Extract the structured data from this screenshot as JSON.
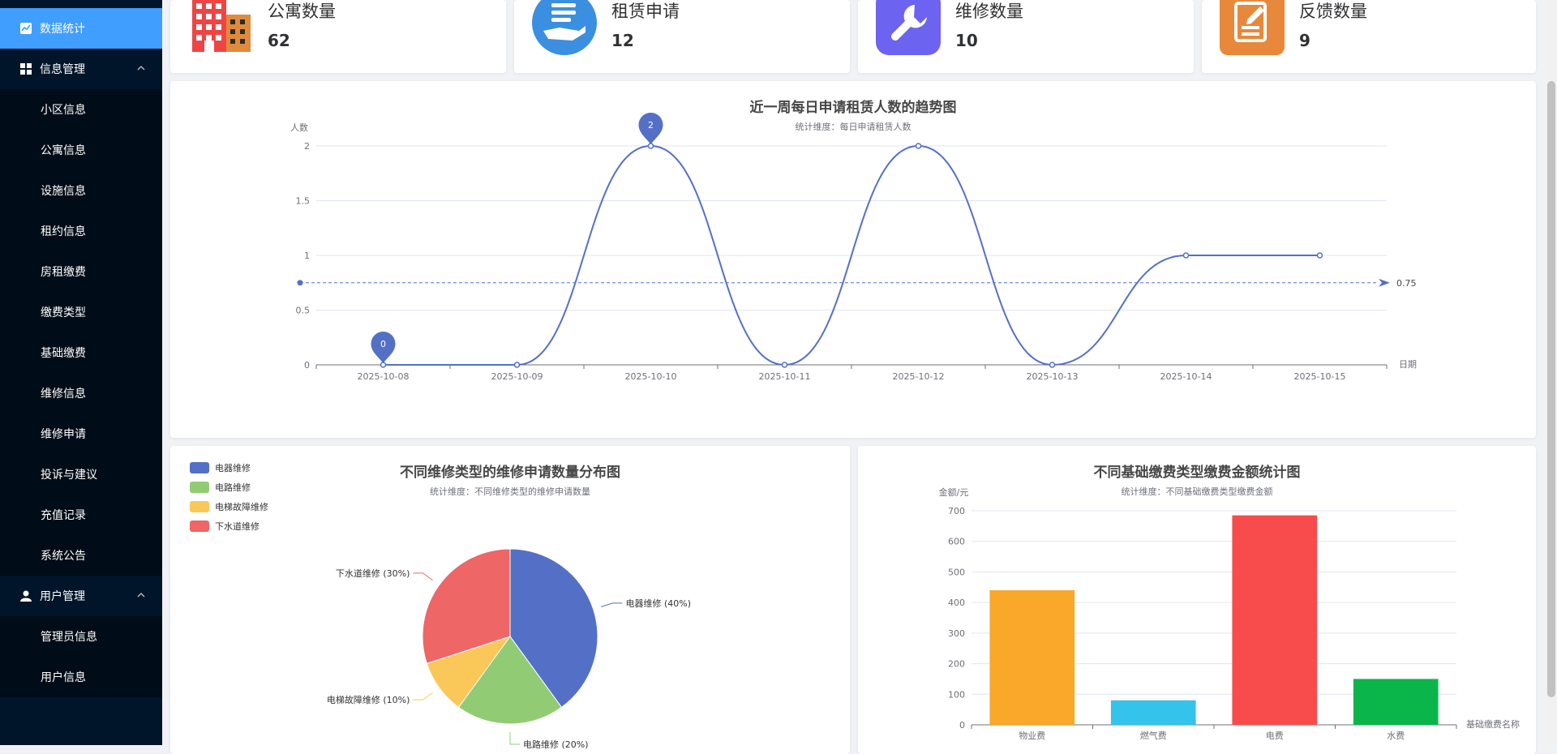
{
  "sidebar": {
    "items": [
      {
        "label": "数据统计",
        "icon": "chart-icon",
        "type": "active"
      },
      {
        "label": "信息管理",
        "icon": "grid-icon",
        "type": "group"
      },
      {
        "label": "小区信息",
        "type": "sub"
      },
      {
        "label": "公寓信息",
        "type": "sub"
      },
      {
        "label": "设施信息",
        "type": "sub"
      },
      {
        "label": "租约信息",
        "type": "sub"
      },
      {
        "label": "房租缴费",
        "type": "sub"
      },
      {
        "label": "缴费类型",
        "type": "sub"
      },
      {
        "label": "基础缴费",
        "type": "sub"
      },
      {
        "label": "维修信息",
        "type": "sub"
      },
      {
        "label": "维修申请",
        "type": "sub"
      },
      {
        "label": "投诉与建议",
        "type": "sub"
      },
      {
        "label": "充值记录",
        "type": "sub"
      },
      {
        "label": "系统公告",
        "type": "sub"
      },
      {
        "label": "用户管理",
        "icon": "user-icon",
        "type": "group"
      },
      {
        "label": "管理员信息",
        "type": "sub"
      },
      {
        "label": "用户信息",
        "type": "sub"
      }
    ]
  },
  "cards": [
    {
      "label": "公寓数量",
      "value": "62",
      "icon": "building-icon",
      "color": "#ef4444"
    },
    {
      "label": "租赁申请",
      "value": "12",
      "icon": "hand-document-icon",
      "color": "#3b8fe0"
    },
    {
      "label": "维修数量",
      "value": "10",
      "icon": "wrench-icon",
      "color": "#6c63f0"
    },
    {
      "label": "反馈数量",
      "value": "9",
      "icon": "edit-note-icon",
      "color": "#e8883a"
    }
  ],
  "charts": {
    "line": {
      "title": "近一周每日申请租赁人数的趋势图",
      "subtitle": "统计维度：每日申请租赁人数",
      "ylabel": "人数",
      "xlabel": "日期",
      "avg_label": "0.75",
      "max_label": "2",
      "min_label": "0"
    },
    "pie": {
      "title": "不同维修类型的维修申请数量分布图",
      "subtitle": "统计维度：不同维修类型的维修申请数量"
    },
    "bar": {
      "title": "不同基础缴费类型缴费金额统计图",
      "subtitle": "统计维度：不同基础缴费类型缴费金额",
      "ylabel": "金额/元",
      "xlabel": "基础缴费名称"
    }
  },
  "chart_data": [
    {
      "type": "line",
      "title": "近一周每日申请租赁人数的趋势图",
      "subtitle": "统计维度：每日申请租赁人数",
      "xlabel": "日期",
      "ylabel": "人数",
      "x": [
        "2025-10-08",
        "2025-10-09",
        "2025-10-10",
        "2025-10-11",
        "2025-10-12",
        "2025-10-13",
        "2025-10-14",
        "2025-10-15"
      ],
      "values": [
        0,
        0,
        2,
        0,
        2,
        0,
        1,
        1
      ],
      "ylim": [
        0,
        2
      ],
      "yticks": [
        0,
        0.5,
        1,
        1.5,
        2
      ],
      "average": 0.75,
      "markers": {
        "max": 2,
        "min": 0
      },
      "grid": true,
      "smooth": true,
      "color": "#5470c6"
    },
    {
      "type": "pie",
      "title": "不同维修类型的维修申请数量分布图",
      "subtitle": "统计维度：不同维修类型的维修申请数量",
      "legend_position": "top-left",
      "slices": [
        {
          "name": "电器维修",
          "percent": 40,
          "label": "电器维修 (40%)",
          "color": "#5470c6"
        },
        {
          "name": "电路维修",
          "percent": 20,
          "label": "电路维修 (20%)",
          "color": "#91cc75"
        },
        {
          "name": "电梯故障维修",
          "percent": 10,
          "label": "电梯故障维修 (10%)",
          "color": "#fac858"
        },
        {
          "name": "下水道维修",
          "percent": 30,
          "label": "下水道维修 (30%)",
          "color": "#ee6666"
        }
      ]
    },
    {
      "type": "bar",
      "title": "不同基础缴费类型缴费金额统计图",
      "subtitle": "统计维度：不同基础缴费类型缴费金额",
      "xlabel": "基础缴费名称",
      "ylabel": "金额/元",
      "categories": [
        "物业费",
        "燃气费",
        "电费",
        "水费"
      ],
      "values": [
        440,
        80,
        685,
        150
      ],
      "colors": [
        "#f9a82a",
        "#34c3ea",
        "#f84b4b",
        "#0ab64a"
      ],
      "ylim": [
        0,
        700
      ],
      "yticks": [
        0,
        100,
        200,
        300,
        400,
        500,
        600,
        700
      ],
      "grid": true
    }
  ]
}
